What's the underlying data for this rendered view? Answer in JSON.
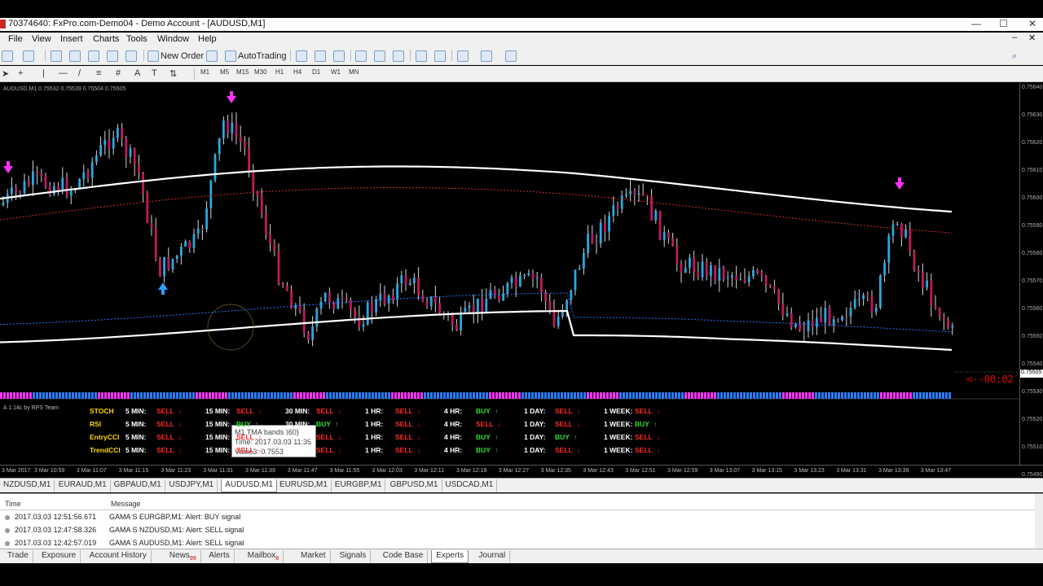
{
  "window": {
    "title": "70374640: FxPro.com-Demo04 - Demo Account - [AUDUSD,M1]"
  },
  "menu": [
    "File",
    "View",
    "Insert",
    "Charts",
    "Tools",
    "Window",
    "Help"
  ],
  "toolbar": {
    "new_order": "New Order",
    "autotrading": "AutoTrading"
  },
  "timeframes": [
    "M1",
    "M5",
    "M15",
    "M30",
    "H1",
    "H4",
    "D1",
    "W1",
    "MN"
  ],
  "chart": {
    "symbol_info": "AUDUSD,M1  0.75532 0.75539 0.75504 0.75505",
    "indicator_label": "A 1.14c by RPS Team",
    "countdown": "<--00:02",
    "current_price": "0.75505",
    "tooltip": {
      "line1": "M1 TMA bands )60)",
      "line2": "Time: 2017.03.03 11:35",
      "line3": "Value3: 0.7553"
    },
    "price_labels": [
      "0.75640",
      "0.75630",
      "0.75620",
      "0.75610",
      "0.75600",
      "0.75590",
      "0.75580",
      "0.75570",
      "0.75560",
      "0.75550",
      "0.75540",
      "0.75530",
      "0.75520",
      "0.75510",
      "0.75490"
    ],
    "time_labels": [
      "3 Mar 2017",
      "3 Mar 10:59",
      "3 Mar 11:07",
      "3 Mar 11:15",
      "3 Mar 11:23",
      "3 Mar 11:31",
      "3 Mar 11:39",
      "3 Mar 11:47",
      "3 Mar 11:55",
      "3 Mar 12:03",
      "3 Mar 12:11",
      "3 Mar 12:19",
      "3 Mar 12:27",
      "3 Mar 12:35",
      "3 Mar 12:43",
      "3 Mar 12:51",
      "3 Mar 12:59",
      "3 Mar 13:07",
      "3 Mar 13:15",
      "3 Mar 13:23",
      "3 Mar 13:31",
      "3 Mar 13:39",
      "3 Mar 13:47"
    ]
  },
  "signal_table": {
    "periods": [
      "5 MIN:",
      "15 MIN:",
      "30 MIN:",
      "1 HR:",
      "4 HR:",
      "1 DAY:",
      "1 WEEK:"
    ],
    "rows": [
      {
        "name": "STOCH",
        "signals": [
          "SELL",
          "SELL",
          "SELL",
          "SELL",
          "BUY",
          "SELL",
          "SELL"
        ]
      },
      {
        "name": "RSI",
        "signals": [
          "SELL",
          "BUY",
          "BUY",
          "SELL",
          "SELL",
          "SELL",
          "BUY"
        ]
      },
      {
        "name": "EntryCCI",
        "signals": [
          "SELL",
          "SELL",
          "SELL",
          "SELL",
          "BUY",
          "BUY",
          "SELL"
        ]
      },
      {
        "name": "TrendCCI",
        "signals": [
          "SELL",
          "SELL",
          "SELL",
          "SELL",
          "BUY",
          "SELL",
          "SELL"
        ]
      }
    ]
  },
  "chart_tabs": [
    "NZDUSD,M1",
    "EURAUD,M1",
    "GBPAUD,M1",
    "USDJPY,M1",
    "AUDUSD,M1",
    "EURUSD,M1",
    "EURGBP,M1",
    "GBPUSD,M1",
    "USDCAD,M1"
  ],
  "active_chart_tab": "AUDUSD,M1",
  "terminal": {
    "col_time": "Time",
    "col_message": "Message",
    "rows": [
      {
        "time": "2017.03.03 12:51:56.671",
        "message": "GAMA S EURGBP,M1: Alert: BUY signal"
      },
      {
        "time": "2017.03.03 12:47:58.326",
        "message": "GAMA S NZDUSD,M1: Alert: SELL signal"
      },
      {
        "time": "2017.03.03 12:42:57.019",
        "message": "GAMA S AUDUSD,M1: Alert: SELL signal"
      }
    ]
  },
  "bottom_tabs": [
    {
      "label": "Trade",
      "badge": ""
    },
    {
      "label": "Exposure",
      "badge": ""
    },
    {
      "label": "Account History",
      "badge": ""
    },
    {
      "label": "News",
      "badge": "99"
    },
    {
      "label": "Alerts",
      "badge": ""
    },
    {
      "label": "Mailbox",
      "badge": "8"
    },
    {
      "label": "Market",
      "badge": ""
    },
    {
      "label": "Signals",
      "badge": ""
    },
    {
      "label": "Code Base",
      "badge": ""
    },
    {
      "label": "Experts",
      "badge": ""
    },
    {
      "label": "Journal",
      "badge": ""
    }
  ],
  "active_bottom_tab": "Experts",
  "colors": {
    "bull_candle": "#29a8e0",
    "bear_candle": "#c2185b",
    "band": "#ffffff",
    "sell": "#ff2a2a",
    "buy": "#33dd33",
    "arrow_down": "#ff33ff",
    "arrow_up": "#2aa0ff"
  }
}
